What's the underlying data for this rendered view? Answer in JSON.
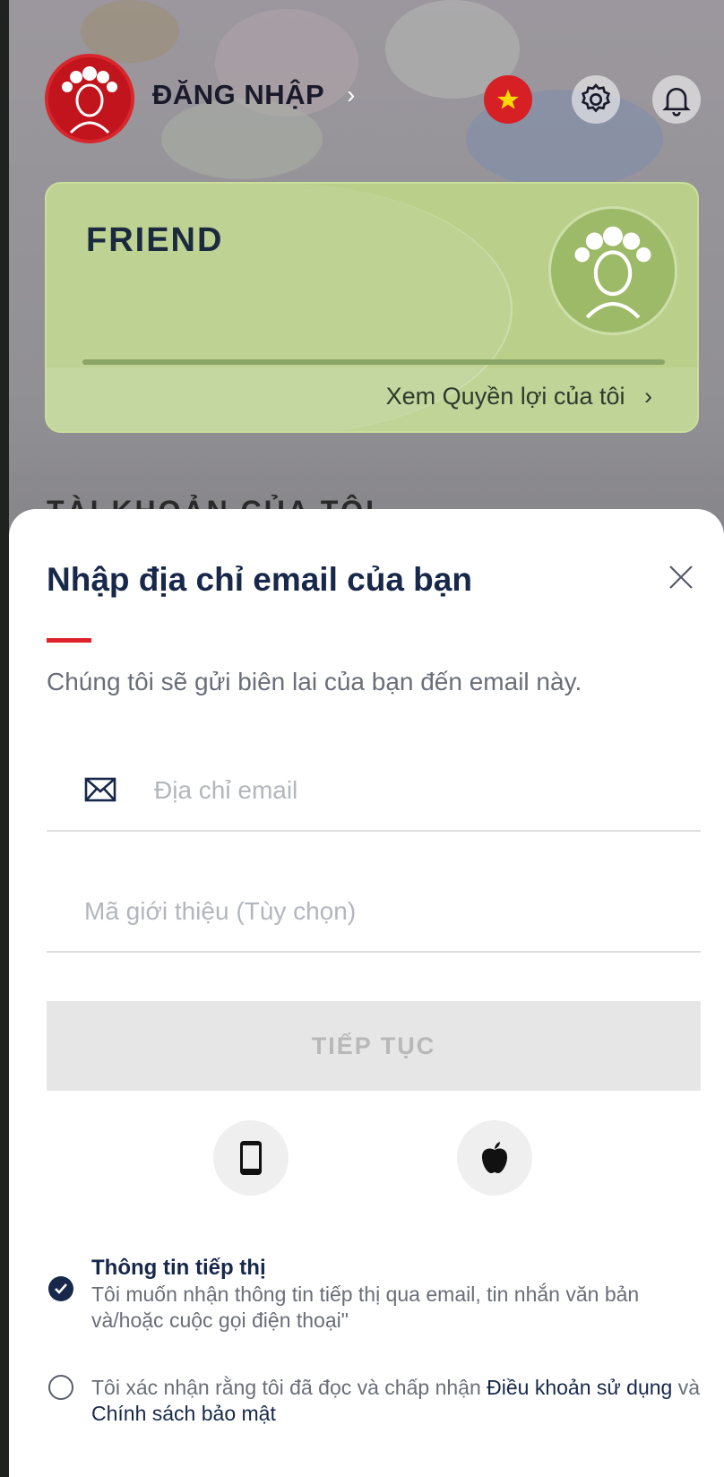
{
  "header": {
    "login_label": "ĐĂNG NHẬP",
    "login_chevron": "›"
  },
  "member_card": {
    "tier": "FRIEND",
    "benefits_link": "Xem Quyền lợi của tôi",
    "benefits_chevron": "›"
  },
  "background_section_heading": "TÀI KHOẢN CỦA TÔI",
  "sheet": {
    "title": "Nhập địa chỉ email của bạn",
    "subtitle": "Chúng tôi sẽ gửi biên lai của bạn đến email này.",
    "email_placeholder": "Địa chỉ email",
    "referral_placeholder": "Mã giới thiệu (Tùy chọn)",
    "continue_label": "TIẾP TỤC",
    "marketing": {
      "title": "Thông tin tiếp thị",
      "text": "Tôi muốn nhận thông tin tiếp thị qua email, tin nhắn văn bản và/hoặc cuộc gọi điện thoại\"",
      "checked": true
    },
    "terms": {
      "prefix": "Tôi xác nhận rằng tôi đã đọc và chấp nhận ",
      "terms_link": "Điều khoản sử dụng",
      "connector": " và ",
      "privacy_link": "Chính sách bảo mật",
      "checked": false
    }
  },
  "colors": {
    "brand_navy": "#17284a",
    "accent_red": "#e0222a",
    "card_green": "#b9cf8a"
  },
  "icons": [
    "avatar-icon",
    "vietnam-flag-icon",
    "gear-icon",
    "bell-icon",
    "close-icon",
    "mail-icon",
    "phone-icon",
    "apple-icon",
    "check-icon"
  ]
}
